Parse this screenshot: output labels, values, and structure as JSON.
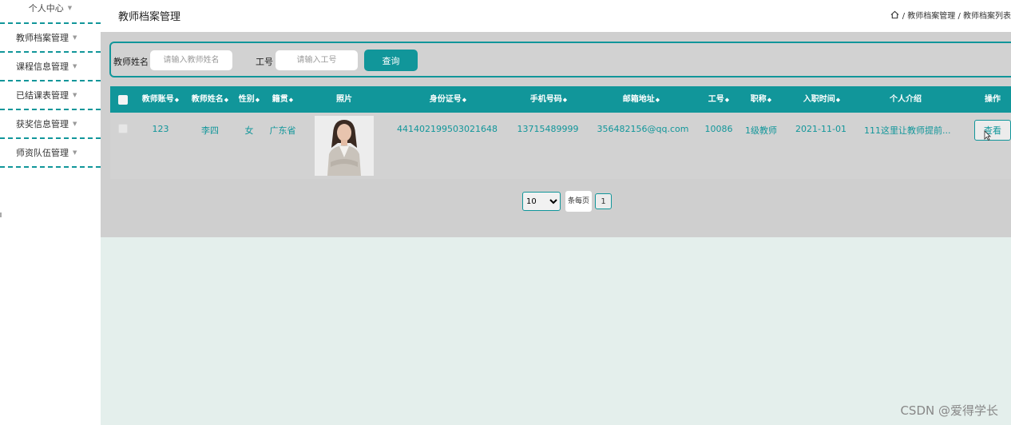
{
  "sidebar": {
    "items": [
      {
        "label": "个人中心"
      },
      {
        "label": "教师档案管理"
      },
      {
        "label": "课程信息管理"
      },
      {
        "label": "已结课表管理"
      },
      {
        "label": "获奖信息管理"
      },
      {
        "label": "师资队伍管理"
      }
    ]
  },
  "header": {
    "title": "教师档案管理",
    "breadcrumb": "/ 教师档案管理 / 教师档案列表"
  },
  "search": {
    "name_label": "教师姓名",
    "name_placeholder": "请输入教师姓名",
    "id_label": "工号",
    "id_placeholder": "请输入工号",
    "button": "查询"
  },
  "table": {
    "columns": [
      "教师账号",
      "教师姓名",
      "性别",
      "籍贯",
      "照片",
      "身份证号",
      "手机号码",
      "邮箱地址",
      "工号",
      "职称",
      "入职时间",
      "个人介绍",
      "操作"
    ],
    "rows": [
      {
        "account": "123",
        "name": "李四",
        "gender": "女",
        "hometown": "广东省",
        "id_card": "441402199503021648",
        "phone": "13715489999",
        "email": "356482156@qq.com",
        "employee_id": "10086",
        "title": "1级教师",
        "join_date": "2021-11-01",
        "intro": "111这里让教师提前...",
        "action": "查看"
      }
    ]
  },
  "pagination": {
    "page_size": "10",
    "page_size_options": [
      "10"
    ],
    "per_page_label": "条每页",
    "current_page": "1"
  },
  "watermark": "CSDN @爱得学长",
  "colors": {
    "accent": "#11969a",
    "content_bg": "#cfcfcf",
    "below_bg": "#e4efec"
  }
}
